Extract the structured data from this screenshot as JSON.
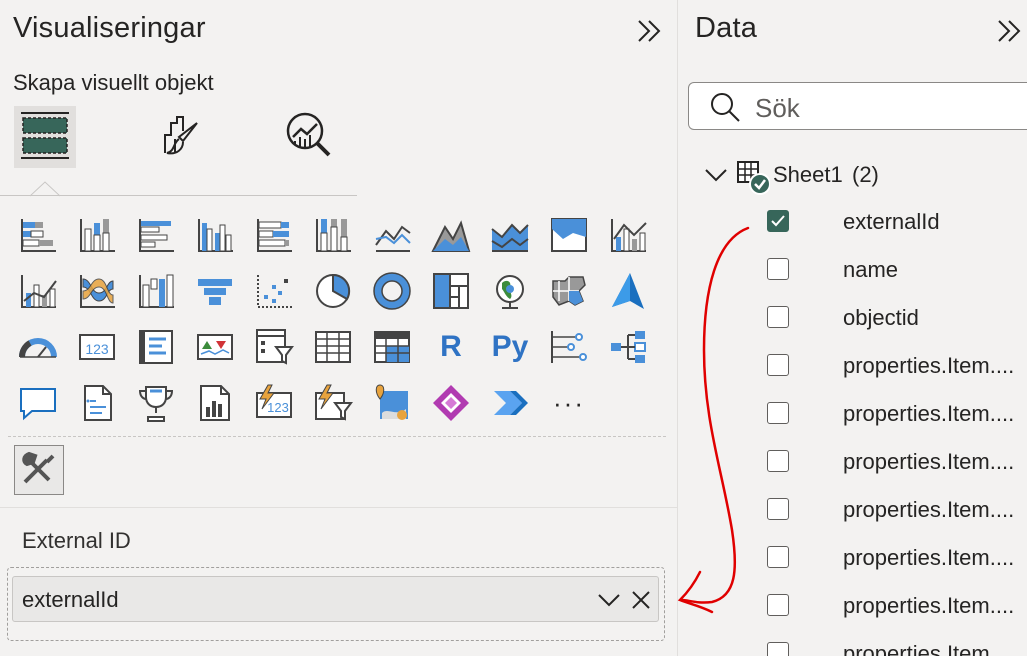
{
  "visualizations": {
    "title": "Visualiseringar",
    "subtitle": "Skapa visuellt objekt",
    "tabs": [
      {
        "name": "build-visual",
        "icon": "build-visual-icon",
        "active": true
      },
      {
        "name": "format-visual",
        "icon": "format-brush-icon",
        "active": false
      },
      {
        "name": "analytics",
        "icon": "analytics-magnifier-icon",
        "active": false
      }
    ],
    "gallery": [
      [
        "stacked-bar-chart-icon",
        "stacked-column-chart-icon",
        "clustered-bar-chart-icon",
        "clustered-column-chart-icon",
        "100-stacked-bar-chart-icon",
        "100-stacked-column-chart-icon",
        "line-chart-icon",
        "area-chart-icon",
        "stacked-area-chart-icon",
        "100-stacked-area-chart-icon",
        "line-and-stacked-column-chart-icon"
      ],
      [
        "line-and-clustered-column-chart-icon",
        "ribbon-chart-icon",
        "waterfall-chart-icon",
        "funnel-chart-icon",
        "scatter-chart-icon",
        "pie-chart-icon",
        "donut-chart-icon",
        "treemap-icon",
        "map-icon",
        "filled-map-icon",
        "azure-map-icon"
      ],
      [
        "gauge-icon",
        "card-icon",
        "multi-row-card-icon",
        "kpi-icon",
        "slicer-icon",
        "table-icon",
        "matrix-icon",
        "r-visual-icon",
        "python-visual-icon",
        "key-influencers-icon",
        "decomposition-tree-icon"
      ],
      [
        "qa-icon",
        "smart-narrative-icon",
        "metrics-icon",
        "paginated-report-icon",
        "power-automate-card-icon",
        "power-automate-slicer-icon",
        "arcgis-map-icon",
        "power-apps-icon",
        "power-automate-icon",
        "more-visuals-icon"
      ]
    ],
    "r_label": "R",
    "py_label": "Py",
    "card_label": "123",
    "more_label": "···",
    "well": {
      "label": "External ID",
      "field_value": "externalId"
    }
  },
  "data": {
    "title": "Data",
    "search_placeholder": "Sök",
    "table": {
      "name": "Sheet1",
      "count": "(2)"
    },
    "fields": [
      {
        "label": "externalId",
        "checked": true
      },
      {
        "label": "name",
        "checked": false
      },
      {
        "label": "objectid",
        "checked": false
      },
      {
        "label": "properties.Item....",
        "checked": false
      },
      {
        "label": "properties.Item....",
        "checked": false
      },
      {
        "label": "properties.Item....",
        "checked": false
      },
      {
        "label": "properties.Item....",
        "checked": false
      },
      {
        "label": "properties.Item....",
        "checked": false
      },
      {
        "label": "properties.Item....",
        "checked": false
      },
      {
        "label": "properties.Item....",
        "checked": false
      }
    ]
  },
  "colors": {
    "accent": "#37665a",
    "blue": "#4a90d9",
    "annotation": "#e00000"
  }
}
